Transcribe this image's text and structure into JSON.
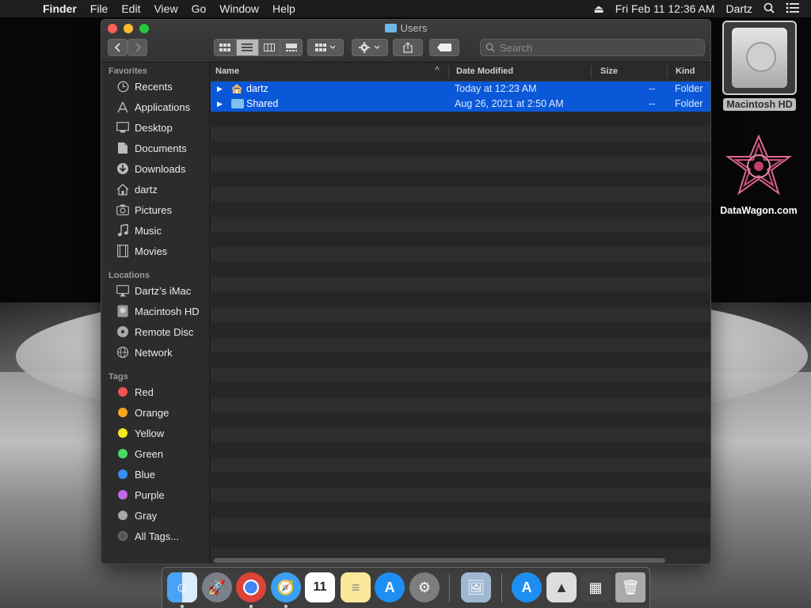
{
  "menubar": {
    "app": "Finder",
    "items": [
      "File",
      "Edit",
      "View",
      "Go",
      "Window",
      "Help"
    ],
    "datetime": "Fri Feb 11  12:36 AM",
    "user": "Dartz"
  },
  "window": {
    "title": "Users",
    "search_placeholder": "Search"
  },
  "sidebar": {
    "favorites_label": "Favorites",
    "favorites": [
      {
        "label": "Recents",
        "icon": "clock-icon"
      },
      {
        "label": "Applications",
        "icon": "applications-icon"
      },
      {
        "label": "Desktop",
        "icon": "desktop-icon"
      },
      {
        "label": "Documents",
        "icon": "documents-icon"
      },
      {
        "label": "Downloads",
        "icon": "downloads-icon"
      },
      {
        "label": "dartz",
        "icon": "home-icon"
      },
      {
        "label": "Pictures",
        "icon": "camera-icon"
      },
      {
        "label": "Music",
        "icon": "music-icon"
      },
      {
        "label": "Movies",
        "icon": "film-icon"
      }
    ],
    "locations_label": "Locations",
    "locations": [
      {
        "label": "Dartz’s iMac",
        "icon": "imac-icon"
      },
      {
        "label": "Macintosh HD",
        "icon": "disk-icon"
      },
      {
        "label": "Remote Disc",
        "icon": "disc-icon"
      },
      {
        "label": "Network",
        "icon": "globe-icon"
      }
    ],
    "tags_label": "Tags",
    "tags": [
      {
        "label": "Red",
        "color": "#ef5350"
      },
      {
        "label": "Orange",
        "color": "#f5a623"
      },
      {
        "label": "Yellow",
        "color": "#f8e71c"
      },
      {
        "label": "Green",
        "color": "#4cd964"
      },
      {
        "label": "Blue",
        "color": "#3a8ef6"
      },
      {
        "label": "Purple",
        "color": "#c169e6"
      },
      {
        "label": "Gray",
        "color": "#a6a6a6"
      },
      {
        "label": "All Tags...",
        "color": "#555555"
      }
    ]
  },
  "table": {
    "columns": [
      "Name",
      "Date Modified",
      "Size",
      "Kind"
    ],
    "rows": [
      {
        "name": "dartz",
        "date": "Today at 12:23 AM",
        "size": "--",
        "kind": "Folder",
        "icon": "home-folder-icon"
      },
      {
        "name": "Shared",
        "date": "Aug 26, 2021 at 2:50 AM",
        "size": "--",
        "kind": "Folder",
        "icon": "folder-icon"
      }
    ]
  },
  "desktop": {
    "icons": [
      {
        "label": "Macintosh HD"
      },
      {
        "label": "DataWagon.com"
      }
    ]
  },
  "colors": {
    "selection": "#0a58d8",
    "window_bg": "#262626",
    "sidebar_bg": "#2c2c2c"
  }
}
